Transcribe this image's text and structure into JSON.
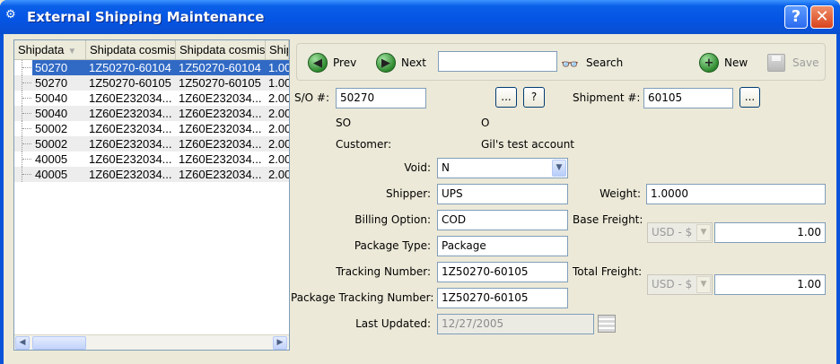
{
  "window": {
    "title": "External Shipping Maintenance"
  },
  "table": {
    "columns": [
      "Shipdata",
      "Shipdata cosmis",
      "Shipdata cosmis",
      "Shipd"
    ],
    "rows": [
      [
        "50270",
        "1Z50270-60104",
        "1Z50270-60104",
        "1.00"
      ],
      [
        "50270",
        "1Z50270-60105",
        "1Z50270-60105",
        "1.00"
      ],
      [
        "50040",
        "1Z60E232034...",
        "1Z60E232034...",
        "2.00"
      ],
      [
        "50040",
        "1Z60E232034...",
        "1Z60E232034...",
        "2.00"
      ],
      [
        "50002",
        "1Z60E232034...",
        "1Z60E232034...",
        "2.00"
      ],
      [
        "50002",
        "1Z60E232034...",
        "1Z60E232034...",
        "2.00"
      ],
      [
        "40005",
        "1Z60E232034...",
        "1Z60E232034...",
        "2.00"
      ],
      [
        "40005",
        "1Z60E232034...",
        "1Z60E232034...",
        "2.00"
      ]
    ],
    "selected_row": 0
  },
  "toolbar": {
    "prev_label": "Prev",
    "next_label": "Next",
    "search_value": "",
    "search_label": "Search",
    "new_label": "New",
    "save_label": "Save"
  },
  "form": {
    "so_label": "S/O #:",
    "so_value": "50270",
    "ellipsis_label": "...",
    "question_label": "?",
    "shipment_label": "Shipment #:",
    "shipment_value": "60105",
    "so_type": "SO",
    "so_status": "O",
    "customer_label": "Customer:",
    "customer_value": "Gil's test account",
    "void_label": "Void:",
    "void_value": "N",
    "shipper_label": "Shipper:",
    "shipper_value": "UPS",
    "billing_label": "Billing Option:",
    "billing_value": "COD",
    "package_type_label": "Package Type:",
    "package_type_value": "Package",
    "tracking_label": "Tracking Number:",
    "tracking_value": "1Z50270-60105",
    "pkg_tracking_label": "Package Tracking Number:",
    "pkg_tracking_value": "1Z50270-60105",
    "last_updated_label": "Last Updated:",
    "last_updated_value": "12/27/2005",
    "weight_label": "Weight:",
    "weight_value": "1.0000",
    "base_freight_label": "Base Freight:",
    "base_currency": "USD - $",
    "base_freight_value": "1.00",
    "total_freight_label": "Total Freight:",
    "total_currency": "USD - $",
    "total_freight_value": "1.00"
  }
}
